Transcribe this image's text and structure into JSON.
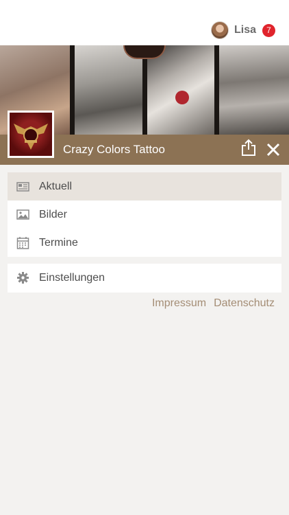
{
  "header": {
    "user_name": "Lisa",
    "notification_count": "7"
  },
  "shop": {
    "name": "Crazy Colors Tattoo"
  },
  "menu": {
    "main_items": [
      {
        "label": "Aktuell",
        "icon": "newspaper-icon",
        "active": true
      },
      {
        "label": "Bilder",
        "icon": "image-icon",
        "active": false
      },
      {
        "label": "Termine",
        "icon": "calendar-icon",
        "active": false
      }
    ],
    "settings_item": {
      "label": "Einstellungen",
      "icon": "gear-icon"
    }
  },
  "footer": {
    "impressum": "Impressum",
    "datenschutz": "Datenschutz"
  },
  "colors": {
    "accent_brown": "#8c7254",
    "badge_red": "#e0242c",
    "link_tan": "#a48d75",
    "active_row": "#e8e3dd"
  }
}
